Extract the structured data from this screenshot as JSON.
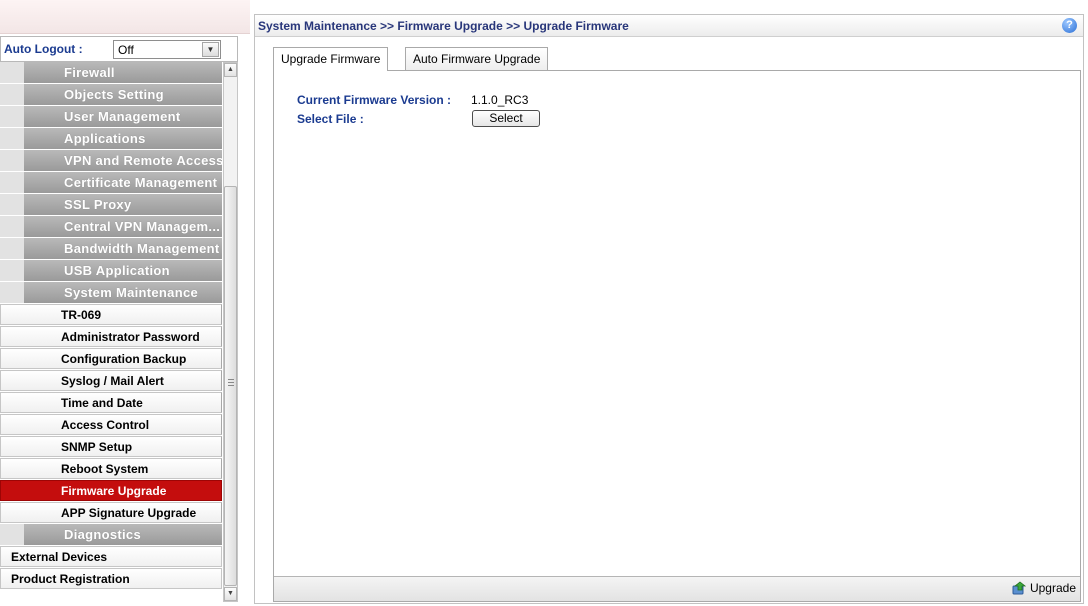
{
  "auto_logout": {
    "label": "Auto Logout :",
    "value": "Off"
  },
  "menu": {
    "categories_top": [
      "Firewall",
      "Objects Setting",
      "User Management",
      "Applications",
      "VPN and Remote Access",
      "Certificate Management",
      "SSL Proxy",
      "Central VPN Managem...",
      "Bandwidth Management",
      "USB Application",
      "System Maintenance"
    ],
    "sub_items": [
      "TR-069",
      "Administrator Password",
      "Configuration Backup",
      "Syslog / Mail Alert",
      "Time and Date",
      "Access Control",
      "SNMP Setup",
      "Reboot System",
      "Firmware Upgrade",
      "APP Signature Upgrade"
    ],
    "active_item": "Firmware Upgrade",
    "diagnostics": "Diagnostics",
    "external_devices": "External Devices",
    "product_registration": "Product Registration"
  },
  "breadcrumb": "System Maintenance >> Firmware Upgrade >> Upgrade Firmware",
  "help_icon": "?",
  "tabs": [
    "Upgrade Firmware",
    "Auto Firmware Upgrade"
  ],
  "form": {
    "current_fw_label": "Current Firmware Version :",
    "current_fw_value": "1.1.0_RC3",
    "select_file_label": "Select File :",
    "select_button": "Select"
  },
  "footer": {
    "upgrade_button": "Upgrade"
  },
  "colors": {
    "active_menu": "#c40d0d",
    "label_blue": "#1b3b90"
  }
}
